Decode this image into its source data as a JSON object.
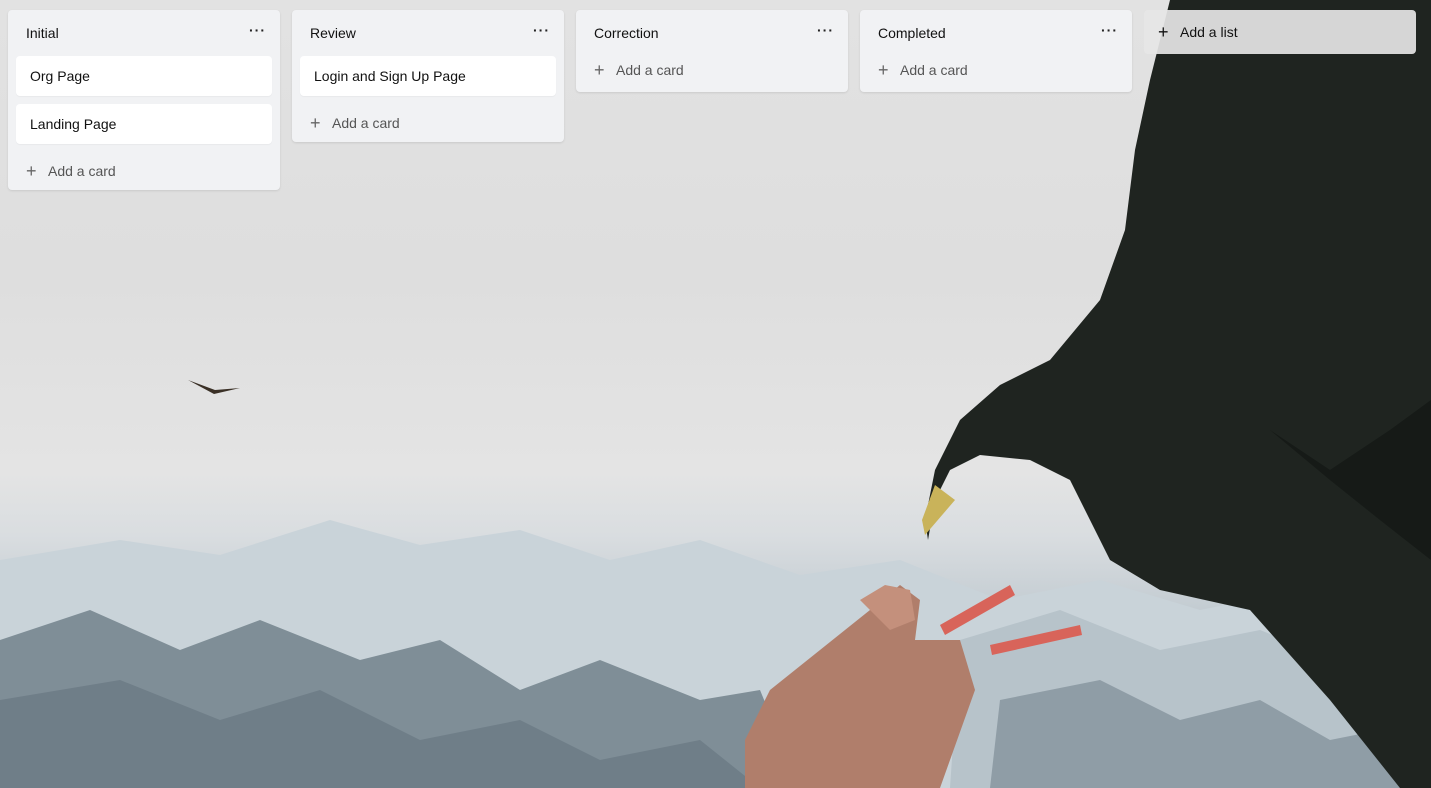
{
  "board": {
    "lists": [
      {
        "title": "Initial",
        "menu": "···",
        "cards": [
          "Org Page",
          "Landing Page"
        ],
        "add_card": "Add a card"
      },
      {
        "title": "Review",
        "menu": "···",
        "cards": [
          "Login and Sign Up Page"
        ],
        "add_card": "Add a card"
      },
      {
        "title": "Correction",
        "menu": "···",
        "cards": [],
        "add_card": "Add a card"
      },
      {
        "title": "Completed",
        "menu": "···",
        "cards": [],
        "add_card": "Add a card"
      }
    ],
    "add_list": "Add a list",
    "plus_glyph": "+"
  },
  "icons": {
    "menu": "ellipsis-icon",
    "add": "plus-icon"
  },
  "colors": {
    "list_bg": "#f1f2f4",
    "card_bg": "#ffffff",
    "text": "#111111",
    "muted": "#555555"
  }
}
